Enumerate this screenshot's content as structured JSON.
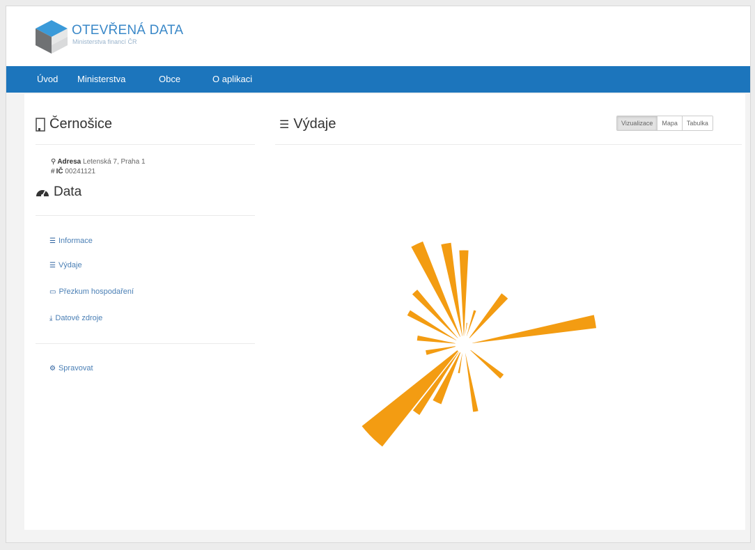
{
  "brand": {
    "title": "OTEVŘENÁ DATA",
    "subtitle": "Ministerstva financí ČR"
  },
  "nav": {
    "items": [
      {
        "label": "Úvod"
      },
      {
        "label": "Ministerstva"
      },
      {
        "label": "Obce"
      },
      {
        "label": "O aplikaci"
      }
    ]
  },
  "sidebar": {
    "entity_title": "Černošice",
    "address_label": "Adresa",
    "address_value": "Letenská 7, Praha 1",
    "ic_label": "IČ",
    "ic_value": "00241121",
    "data_title": "Data",
    "links": [
      {
        "label": "Informace",
        "icon": "list-icon"
      },
      {
        "label": "Výdaje",
        "icon": "list-icon"
      },
      {
        "label": "Přezkum hospodaření",
        "icon": "monitor-icon"
      },
      {
        "label": "Datové zdroje",
        "icon": "download-icon"
      }
    ],
    "manage_label": "Spravovat"
  },
  "main": {
    "title": "Výdaje",
    "view_buttons": [
      {
        "label": "Vizualizace",
        "active": true
      },
      {
        "label": "Mapa",
        "active": false
      },
      {
        "label": "Tabulka",
        "active": false
      }
    ]
  },
  "colors": {
    "navbar": "#1c75bc",
    "link": "#4a7fb5",
    "wedge": "#f39c12"
  },
  "chart_data": {
    "type": "radial-bar",
    "center_hole": true,
    "unit": "relative",
    "values": [
      0.88,
      0.22,
      0.28,
      0.4,
      0.46,
      0.74,
      0.68,
      0.62,
      0.2,
      0.1,
      0.4,
      0.9,
      0.3,
      0.43,
      0.15,
      0.4,
      0.54
    ]
  }
}
